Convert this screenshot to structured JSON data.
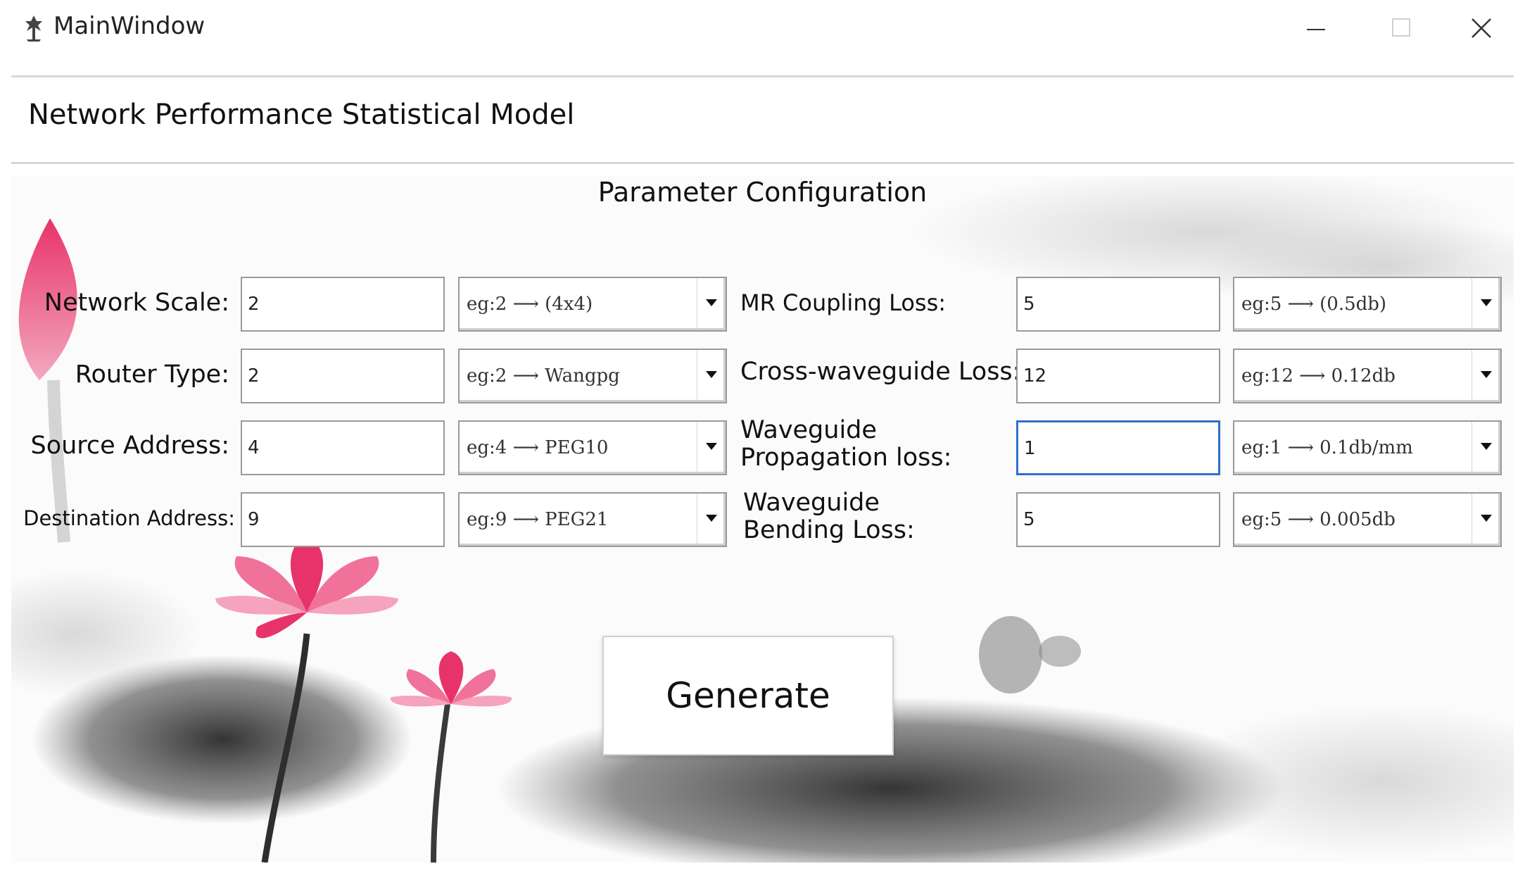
{
  "window": {
    "title": "MainWindow"
  },
  "app": {
    "heading": "Network Performance Statistical Model"
  },
  "section": {
    "title": "Parameter Configuration"
  },
  "left_params": [
    {
      "label": "Network Scale:",
      "value": "2",
      "example": "eg:2 ⟶ (4x4)"
    },
    {
      "label": "Router Type:",
      "value": "2",
      "example": "eg:2 ⟶ Wangpg"
    },
    {
      "label": "Source Address:",
      "value": "4",
      "example": "eg:4 ⟶ PEG10"
    },
    {
      "label": "Destination Address:",
      "value": "9",
      "example": "eg:9 ⟶ PEG21"
    }
  ],
  "right_params": [
    {
      "label": "MR Coupling Loss:",
      "value": "5",
      "example": "eg:5 ⟶ (0.5db)"
    },
    {
      "label": "Cross-waveguide Loss:",
      "value": "12",
      "example": "eg:12 ⟶ 0.12db"
    },
    {
      "label_line1": "Waveguide",
      "label_line2": "Propagation loss:",
      "value": "1",
      "example": "eg:1 ⟶ 0.1db/mm"
    },
    {
      "label_line1": "Waveguide",
      "label_line2": "Bending Loss:",
      "value": "5",
      "example": "eg:5 ⟶ 0.005db"
    }
  ],
  "actions": {
    "generate_label": "Generate"
  },
  "colors": {
    "lotus": "#e8336a",
    "focus": "#2f6fcc",
    "ink": "#2a2a2a"
  },
  "icons": [
    "app-icon",
    "minimize-icon",
    "maximize-icon",
    "close-icon",
    "dropdown-arrow-icon"
  ]
}
